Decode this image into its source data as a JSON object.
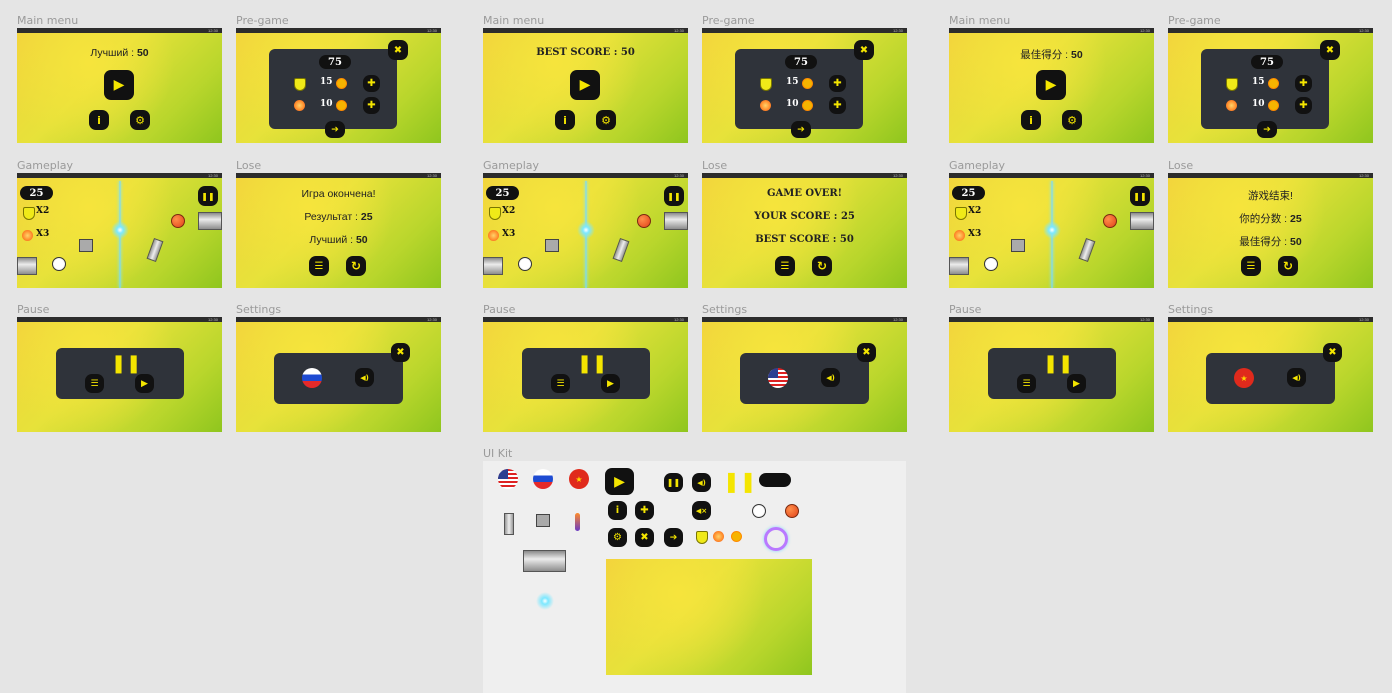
{
  "columns": [
    {
      "lang": "ru",
      "labels": {
        "main_menu": "Main menu",
        "pre_game": "Pre-game",
        "gameplay": "Gameplay",
        "lose": "Lose",
        "pause": "Pause",
        "settings": "Settings"
      },
      "main_menu": {
        "best_label": "Лучший : ",
        "best_value": "50"
      },
      "pre_game": {
        "score": "75",
        "shield_count": "15",
        "gear_count": "10"
      },
      "gameplay": {
        "score": "25",
        "shield_mult": "X2",
        "gear_mult": "X3"
      },
      "lose": {
        "title": "Игра окончена!",
        "result_label": "Результат : ",
        "result_value": "25",
        "best_label": "Лучший : ",
        "best_value": "50"
      },
      "settings": {
        "flag": "ru"
      }
    },
    {
      "lang": "en",
      "labels": {
        "main_menu": "Main menu",
        "pre_game": "Pre-game",
        "gameplay": "Gameplay",
        "lose": "Lose",
        "pause": "Pause",
        "settings": "Settings"
      },
      "main_menu": {
        "best_label": "BEST SCORE : ",
        "best_value": "50"
      },
      "pre_game": {
        "score": "75",
        "shield_count": "15",
        "gear_count": "10"
      },
      "gameplay": {
        "score": "25",
        "shield_mult": "X2",
        "gear_mult": "X3"
      },
      "lose": {
        "title": "GAME OVER!",
        "result_label": "YOUR SCORE : ",
        "result_value": "25",
        "best_label": "BEST SCORE : ",
        "best_value": "50"
      },
      "settings": {
        "flag": "us"
      }
    },
    {
      "lang": "zh",
      "labels": {
        "main_menu": "Main menu",
        "pre_game": "Pre-game",
        "gameplay": "Gameplay",
        "lose": "Lose",
        "pause": "Pause",
        "settings": "Settings"
      },
      "main_menu": {
        "best_label": "最佳得分 : ",
        "best_value": "50"
      },
      "pre_game": {
        "score": "75",
        "shield_count": "15",
        "gear_count": "10"
      },
      "gameplay": {
        "score": "25",
        "shield_mult": "X2",
        "gear_mult": "X3"
      },
      "lose": {
        "title": "游戏结束!",
        "result_label": "你的分数 : ",
        "result_value": "25",
        "best_label": "最佳得分 : ",
        "best_value": "50"
      },
      "settings": {
        "flag": "cn"
      }
    }
  ],
  "ui_kit": {
    "label": "UI Kit"
  },
  "statusbar": {
    "time": "12:30"
  },
  "colors": {
    "accent": "#f4e500",
    "button": "#111111",
    "panel": "#2f333a",
    "canvas": "#e5e5e5"
  },
  "icons": {
    "play": "play-icon",
    "info": "info-icon",
    "settings": "gear-icon",
    "close": "close-icon",
    "plus": "plus-icon",
    "next": "arrow-right-icon",
    "pause": "pause-icon",
    "menu": "menu-icon",
    "restart": "restart-icon",
    "sound": "sound-icon",
    "mute": "mute-icon"
  }
}
